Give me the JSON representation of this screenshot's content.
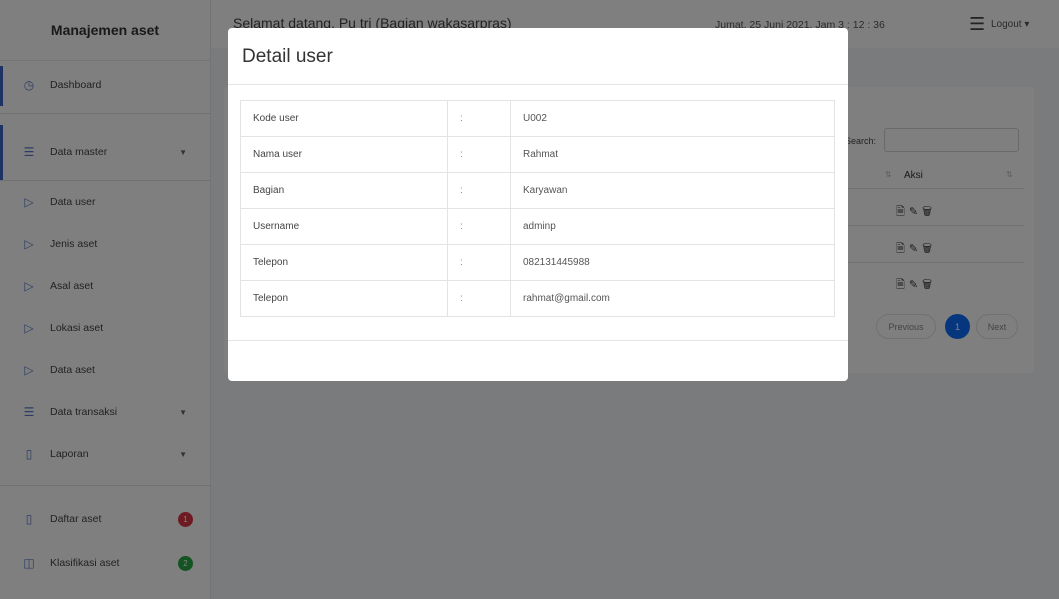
{
  "sidebar": {
    "brand": "Manajemen aset",
    "items": [
      {
        "label": "Dashboard",
        "icon": "dashboard-icon",
        "glyph": "◷"
      },
      {
        "label": "Data master",
        "icon": "list-icon",
        "glyph": "☰"
      },
      {
        "label": "Data user",
        "icon": "chevron-right-icon",
        "glyph": "▷"
      },
      {
        "label": "Jenis aset",
        "icon": "chevron-right-icon",
        "glyph": "▷"
      },
      {
        "label": "Asal aset",
        "icon": "chevron-right-icon",
        "glyph": "▷"
      },
      {
        "label": "Lokasi aset",
        "icon": "chevron-right-icon",
        "glyph": "▷"
      },
      {
        "label": "Data aset",
        "icon": "chevron-right-icon",
        "glyph": "▷"
      },
      {
        "label": "Data transaksi",
        "icon": "list-icon",
        "glyph": "☰"
      },
      {
        "label": "Laporan",
        "icon": "file-icon",
        "glyph": "▯"
      },
      {
        "label": "Daftar aset",
        "icon": "clipboard-icon",
        "glyph": "▯",
        "badge": "1",
        "badge_color": "#dc3545"
      },
      {
        "label": "Klasifikasi aset",
        "icon": "grid-icon",
        "glyph": "◫",
        "badge": "2",
        "badge_color": "#28a745"
      }
    ]
  },
  "header": {
    "welcome": "Selamat datang, Pu tri (Bagian wakasarpras)",
    "datetime": "Jumat, 25 Juni 2021, Jam 3 : 12 : 36",
    "logout": "Logout"
  },
  "table_bg": {
    "search_label": "Search:",
    "action_header": "Aksi",
    "pagination": {
      "previous": "Previous",
      "page": "1",
      "next": "Next"
    }
  },
  "modal": {
    "title": "Detail user",
    "rows": [
      {
        "label": "Kode user",
        "sep": ":",
        "value": "U002"
      },
      {
        "label": "Nama user",
        "sep": ":",
        "value": "Rahmat"
      },
      {
        "label": "Bagian",
        "sep": ":",
        "value": "Karyawan"
      },
      {
        "label": "Username",
        "sep": ":",
        "value": "adminp"
      },
      {
        "label": "Telepon",
        "sep": ":",
        "value": "082131445988"
      },
      {
        "label": "Telepon",
        "sep": ":",
        "value": "rahmat@gmail.com"
      }
    ]
  },
  "colors": {
    "accent": "#3c66c9",
    "primary": "#0d6efd",
    "danger": "#dc3545",
    "success": "#28a745"
  }
}
